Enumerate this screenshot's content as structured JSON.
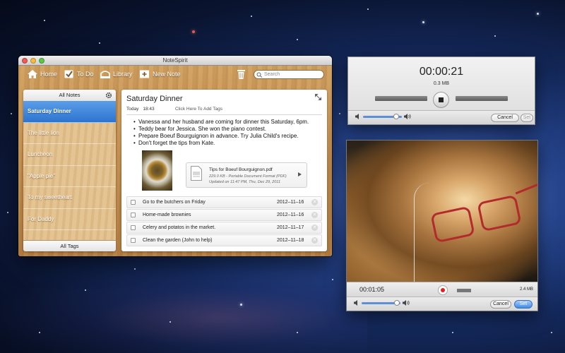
{
  "main_window": {
    "title": "NoteSpirit",
    "toolbar": {
      "home": "Home",
      "todo": "To Do",
      "library": "Library",
      "new_note": "New Note",
      "search_placeholder": "Search"
    },
    "sidebar": {
      "header": "All Notes",
      "footer": "All Tags",
      "items": [
        {
          "label": "Saturday Dinner",
          "active": true
        },
        {
          "label": "The little lion"
        },
        {
          "label": "Luncheon"
        },
        {
          "label": "\"Apple pie\""
        },
        {
          "label": "To my sweetheart"
        },
        {
          "label": "For Daddy"
        }
      ]
    },
    "note": {
      "title": "Saturday Dinner",
      "date": "Today",
      "time": "18:43",
      "tags_prompt": "Click Here To Add Tags",
      "bullets": [
        "Vanessa and her husband are coming for dinner this Saturday, 6pm.",
        "Teddy bear for Jessica. She won the piano contest.",
        "Prepare Boeuf Bourguignon in advance. Try Julia Child's recipe.",
        "Don't forget the tips from Kate."
      ],
      "attachment": {
        "name": "Tips for Boeuf Bourguignon.pdf",
        "info_line1": "229.0 KB - Portable Document Format (PDF)",
        "info_line2": "Updated on 11:47 PM, Thu, Dec 29, 2011"
      },
      "todos": [
        {
          "text": "Go to the butchers on Friday",
          "date": "2012–11–16"
        },
        {
          "text": "Home-made brownies",
          "date": "2012–11–16"
        },
        {
          "text": "Celery and potatos in the market.",
          "date": "2012–11–17"
        },
        {
          "text": "Clean the garden (John to help)",
          "date": "2012–11–18"
        }
      ]
    }
  },
  "audio_recorder": {
    "elapsed": "00:00:21",
    "size": "0.3 MB",
    "volume": 0.85,
    "cancel": "Cancel",
    "set": "Set"
  },
  "video_recorder": {
    "elapsed": "00:01:05",
    "size": "2.4 MB",
    "volume": 0.9,
    "cancel": "Cancel",
    "set": "Set"
  },
  "colors": {
    "selection_blue": "#2c74cf",
    "record_red": "#e02020",
    "wood": "#c08a4c"
  }
}
